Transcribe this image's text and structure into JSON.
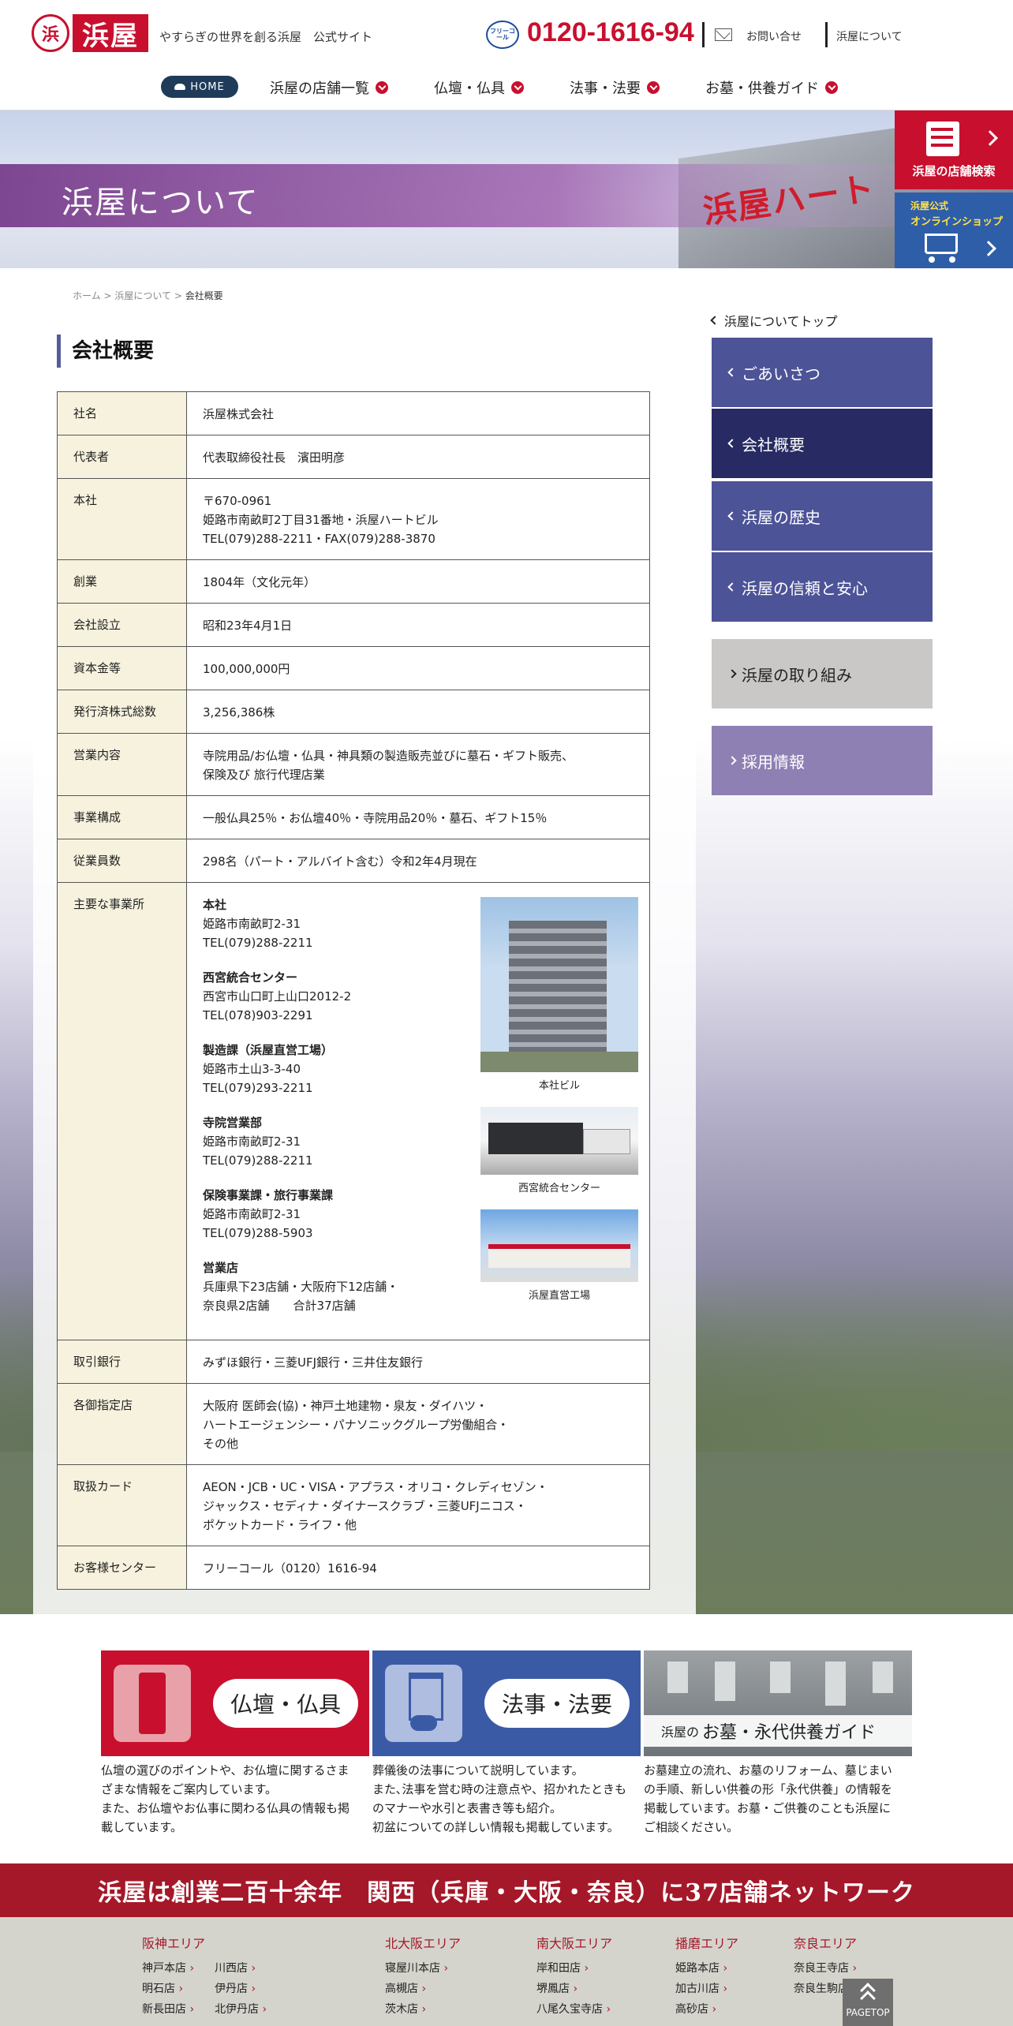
{
  "header": {
    "logo_mark": "浜",
    "logo_text": "浜屋",
    "tagline": "やすらぎの世界を創る浜屋　公式サイト",
    "freecall_icon": "フリーコール",
    "phone": "0120-1616-94",
    "contact_label": "お問い合せ",
    "about_label": "浜屋について"
  },
  "nav": {
    "home": "HOME",
    "items": [
      "浜屋の店舗一覧",
      "仏壇・仏具",
      "法事・法要",
      "お墓・供養ガイド"
    ]
  },
  "hero": {
    "title": "浜屋について",
    "sign": "浜屋ハート"
  },
  "side_fixed": {
    "search_label": "浜屋の店舗検索",
    "shop_line1": "浜屋公式",
    "shop_line2": "オンラインショップ"
  },
  "breadcrumb": {
    "home": "ホーム",
    "sep": ">",
    "parent": "浜屋について",
    "current": "会社概要"
  },
  "page_title": "会社概要",
  "company_table": [
    {
      "label": "社名",
      "value": "浜屋株式会社"
    },
    {
      "label": "代表者",
      "value": "代表取締役社長　濱田明彦"
    },
    {
      "label": "本社",
      "value": "〒670-0961\n姫路市南畝町2丁目31番地・浜屋ハートビル\nTEL(079)288-2211・FAX(079)288-3870"
    },
    {
      "label": "創業",
      "value": "1804年（文化元年）"
    },
    {
      "label": "会社設立",
      "value": "昭和23年4月1日"
    },
    {
      "label": "資本金等",
      "value": "100,000,000円"
    },
    {
      "label": "発行済株式総数",
      "value": "3,256,386株"
    },
    {
      "label": "営業内容",
      "value": "寺院用品/お仏壇・仏具・神具類の製造販売並びに墓石・ギフト販売、\n保険及び 旅行代理店業"
    },
    {
      "label": "事業構成",
      "value": "一般仏具25％・お仏壇40％・寺院用品20％・墓石、ギフト15％"
    },
    {
      "label": "従業員数",
      "value": "298名（パート・アルバイト含む）令和2年4月現在"
    }
  ],
  "offices": {
    "label": "主要な事業所",
    "items": [
      {
        "name": "本社",
        "detail": "姫路市南畝町2-31\nTEL(079)288-2211"
      },
      {
        "name": "西宮統合センター",
        "detail": "西宮市山口町上山口2012-2\nTEL(078)903-2291"
      },
      {
        "name": "製造課（浜屋直営工場）",
        "detail": "姫路市土山3-3-40\nTEL(079)293-2211"
      },
      {
        "name": "寺院営業部",
        "detail": "姫路市南畝町2-31\nTEL(079)288-2211"
      },
      {
        "name": "保険事業課・旅行事業課",
        "detail": "姫路市南畝町2-31\nTEL(079)288-5903"
      },
      {
        "name": "営業店",
        "detail": "兵庫県下23店舗・大阪府下12店舗・\n奈良県2店舗　　合計37店舗"
      }
    ],
    "photos": [
      "本社ビル",
      "西宮統合センター",
      "浜屋直営工場"
    ]
  },
  "company_table_2": [
    {
      "label": "取引銀行",
      "value": "みずほ銀行・三菱UFJ銀行・三井住友銀行"
    },
    {
      "label": "各御指定店",
      "value": "大阪府 医師会(協)・神戸土地建物・泉友・ダイハツ・\nハートエージェンシー・パナソニックグループ労働組合・\nその他"
    },
    {
      "label": "取扱カード",
      "value": "AEON・JCB・UC・VISA・アプラス・オリコ・クレディセゾン・\nジャックス・セディナ・ダイナースクラブ・三菱UFJニコス・\nポケットカード・ライフ・他"
    },
    {
      "label": "お客様センター",
      "value": "フリーコール（0120）1616-94"
    }
  ],
  "side_nav": {
    "top": "浜屋についてトップ",
    "items": [
      "ごあいさつ",
      "会社概要",
      "浜屋の歴史",
      "浜屋の信頼と安心"
    ],
    "efforts": "浜屋の取り組み",
    "recruit": "採用情報"
  },
  "guides": [
    {
      "label": "仏壇・仏具",
      "desc": "仏壇の選びのポイントや、お仏壇に関するさま\nざまな情報をご案内しています。\nまた、お仏壇やお仏事に関わる仏具の情報も掲\n載しています。"
    },
    {
      "label": "法事・法要",
      "desc": "葬儀後の法事について説明しています。\nまた､法事を営む時の注意点や、招かれたときも\nのマナーや水引と表書き等も紹介。\n初盆についての詳しい情報も掲載しています。"
    },
    {
      "label_small": "浜屋の",
      "label": "お墓・永代供養ガイド",
      "desc": "お墓建立の流れ、お墓のリフォーム、墓じまい\nの手順、新しい供養の形「永代供養」の情報を\n掲載しています。お墓・ご供養のことも浜屋に\nご相談ください。"
    }
  ],
  "network_banner": "浜屋は創業二百十余年　関西（兵庫・大阪・奈良）に37店舗ネットワーク",
  "areas": [
    {
      "title": "阪神エリア",
      "cols": [
        [
          "神戸本店",
          "明石店",
          "新長田店"
        ],
        [
          "川西店",
          "伊丹店",
          "北伊丹店"
        ]
      ]
    },
    {
      "title": "北大阪エリア",
      "cols": [
        [
          "寝屋川本店",
          "高槻店",
          "茨木店"
        ]
      ]
    },
    {
      "title": "南大阪エリア",
      "cols": [
        [
          "岸和田店",
          "堺鳳店",
          "八尾久宝寺店"
        ]
      ]
    },
    {
      "title": "播磨エリア",
      "cols": [
        [
          "姫路本店",
          "加古川店",
          "高砂店"
        ]
      ]
    },
    {
      "title": "奈良エリア",
      "cols": [
        [
          "奈良王寺店",
          "奈良生駒店"
        ]
      ]
    }
  ],
  "pagetop": "PAGETOP",
  "colors": {
    "brand_red": "#c8102e",
    "nav_purple": "#4c5397",
    "nav_active": "#272a63",
    "recruit": "#8f80b3",
    "banner_red": "#a51829"
  }
}
